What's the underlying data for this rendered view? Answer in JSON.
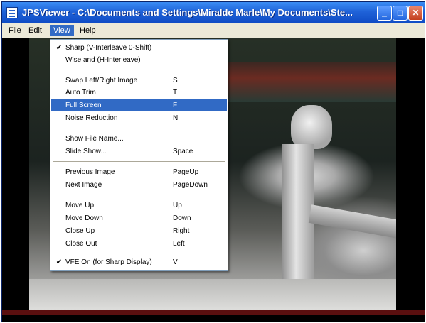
{
  "window": {
    "title": "JPSViewer - C:\\Documents and Settings\\Miralde Marle\\My Documents\\Ste...",
    "buttons": {
      "minimize": "_",
      "maximize": "□",
      "close": "✕"
    }
  },
  "menubar": {
    "items": [
      {
        "label": "File"
      },
      {
        "label": "Edit"
      },
      {
        "label": "View"
      },
      {
        "label": "Help"
      }
    ]
  },
  "view_menu": {
    "groups": [
      [
        {
          "label": "Sharp (V-Interleave 0-Shift)",
          "shortcut": "",
          "checked": "✔"
        },
        {
          "label": "Wise and (H-Interleave)",
          "shortcut": "",
          "checked": ""
        }
      ],
      [
        {
          "label": "Swap Left/Right Image",
          "shortcut": "S",
          "checked": ""
        },
        {
          "label": "Auto Trim",
          "shortcut": "T",
          "checked": ""
        },
        {
          "label": "Full Screen",
          "shortcut": "F",
          "checked": "",
          "highlighted": true
        },
        {
          "label": "Noise Reduction",
          "shortcut": "N",
          "checked": ""
        }
      ],
      [
        {
          "label": "Show File Name...",
          "shortcut": "",
          "checked": ""
        },
        {
          "label": "Slide Show...",
          "shortcut": "Space",
          "checked": ""
        }
      ],
      [
        {
          "label": "Previous Image",
          "shortcut": "PageUp",
          "checked": ""
        },
        {
          "label": "Next Image",
          "shortcut": "PageDown",
          "checked": ""
        }
      ],
      [
        {
          "label": "Move Up",
          "shortcut": "Up",
          "checked": ""
        },
        {
          "label": "Move Down",
          "shortcut": "Down",
          "checked": ""
        },
        {
          "label": "Close Up",
          "shortcut": "Right",
          "checked": ""
        },
        {
          "label": "Close Out",
          "shortcut": "Left",
          "checked": ""
        }
      ],
      [
        {
          "label": "VFE On (for Sharp Display)",
          "shortcut": "V",
          "checked": "✔"
        }
      ]
    ]
  },
  "colors": {
    "titlebar": "#1f62d8",
    "menu_highlight": "#316ac5",
    "menu_bg": "#ffffff",
    "menubar_bg": "#ece9d8"
  }
}
